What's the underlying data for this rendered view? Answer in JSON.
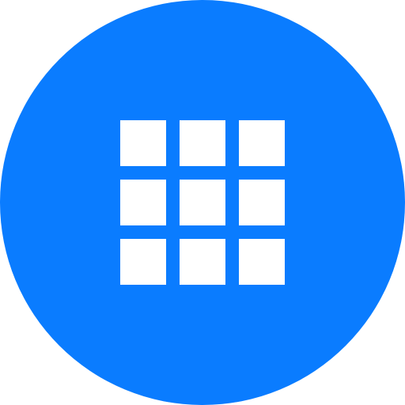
{
  "launcher": {
    "icon": "grid-icon",
    "background_color": "#0a7cff",
    "icon_color": "#ffffff",
    "rows": 3,
    "columns": 3
  }
}
